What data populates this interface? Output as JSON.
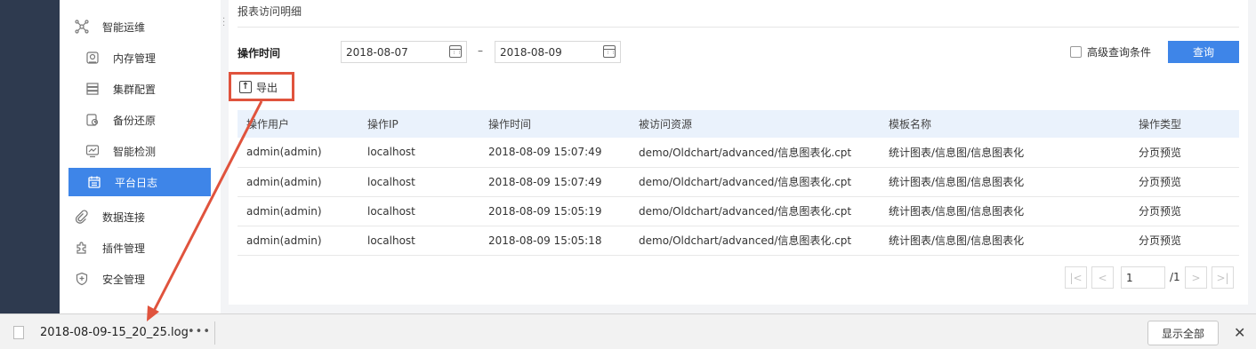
{
  "sidebar": {
    "items": [
      {
        "label": "智能运维",
        "icon": "network-icon",
        "level": "top"
      },
      {
        "label": "内存管理",
        "icon": "memory-icon",
        "level": "sub"
      },
      {
        "label": "集群配置",
        "icon": "cluster-icon",
        "level": "sub"
      },
      {
        "label": "备份还原",
        "icon": "backup-icon",
        "level": "sub"
      },
      {
        "label": "智能检测",
        "icon": "monitor-icon",
        "level": "sub"
      },
      {
        "label": "平台日志",
        "icon": "log-icon",
        "level": "sub",
        "active": true
      },
      {
        "label": "数据连接",
        "icon": "link-icon",
        "level": "top"
      },
      {
        "label": "插件管理",
        "icon": "plugin-icon",
        "level": "top"
      },
      {
        "label": "安全管理",
        "icon": "shield-icon",
        "level": "top"
      }
    ]
  },
  "main": {
    "section_title": "报表访问明细",
    "filter": {
      "label": "操作时间",
      "start_date": "2018-08-07",
      "separator": "–",
      "end_date": "2018-08-09",
      "advanced_label": "高级查询条件",
      "query_label": "查询"
    },
    "export_label": "导出",
    "table": {
      "headers": [
        "操作用户",
        "操作IP",
        "操作时间",
        "被访问资源",
        "模板名称",
        "操作类型"
      ],
      "rows": [
        [
          "admin(admin)",
          "localhost",
          "2018-08-09 15:07:49",
          "demo/Oldchart/advanced/信息图表化.cpt",
          "统计图表/信息图/信息图表化",
          "分页预览"
        ],
        [
          "admin(admin)",
          "localhost",
          "2018-08-09 15:07:49",
          "demo/Oldchart/advanced/信息图表化.cpt",
          "统计图表/信息图/信息图表化",
          "分页预览"
        ],
        [
          "admin(admin)",
          "localhost",
          "2018-08-09 15:05:19",
          "demo/Oldchart/advanced/信息图表化.cpt",
          "统计图表/信息图/信息图表化",
          "分页预览"
        ],
        [
          "admin(admin)",
          "localhost",
          "2018-08-09 15:05:18",
          "demo/Oldchart/advanced/信息图表化.cpt",
          "统计图表/信息图/信息图表化",
          "分页预览"
        ]
      ]
    },
    "pager": {
      "first": "|<",
      "prev": "<",
      "page": "1",
      "total": "/1",
      "next": ">",
      "last": ">|"
    }
  },
  "download_bar": {
    "file_name": "2018-08-09-15_20_25.log",
    "more": "•••",
    "show_all": "显示全部",
    "close": "✕"
  },
  "colors": {
    "accent": "#3e85e8",
    "annotation": "#e0533d",
    "sidebar_dark": "#2e3a4f"
  }
}
